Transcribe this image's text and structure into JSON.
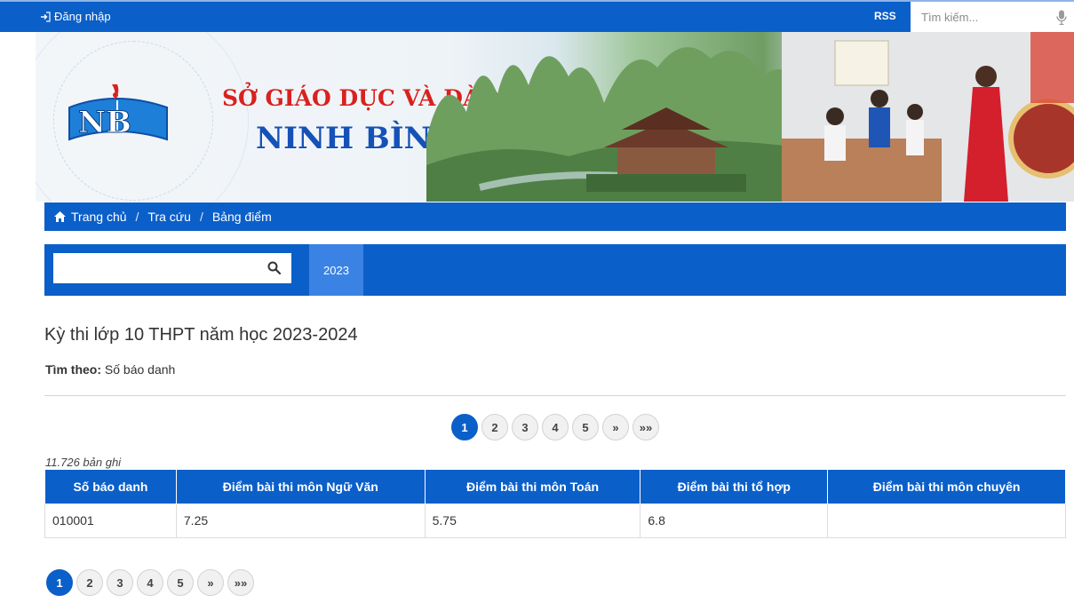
{
  "topbar": {
    "login_label": "Đăng nhập",
    "rss_label": "RSS",
    "search_placeholder": "Tìm kiếm..."
  },
  "banner": {
    "org_line1": "SỞ GIÁO DỤC VÀ ĐÀO TẠO",
    "org_line2": "NINH BÌNH",
    "logo_text": "NB"
  },
  "breadcrumb": [
    {
      "label": "Trang chủ",
      "icon": "home-icon"
    },
    {
      "label": "Tra cứu"
    },
    {
      "label": "Bảng điểm"
    }
  ],
  "search_panel": {
    "query": "",
    "year_tab": "2023"
  },
  "content": {
    "title": "Kỳ thi lớp 10 THPT năm học 2023-2024",
    "find_by_label": "Tìm theo:",
    "find_by_value": "Số báo danh",
    "record_count": "11.726 bản ghi"
  },
  "pagination": {
    "pages": [
      "1",
      "2",
      "3",
      "4",
      "5"
    ],
    "current": "1",
    "next": "»",
    "last": "»»"
  },
  "table": {
    "headers": [
      "Số báo danh",
      "Điểm bài thi môn Ngữ Văn",
      "Điểm bài thi môn Toán",
      "Điểm bài thi tổ hợp",
      "Điểm bài thi môn chuyên"
    ],
    "rows": [
      [
        "010001",
        "7.25",
        "5.75",
        "6.8",
        ""
      ]
    ]
  },
  "colors": {
    "primary": "#0b5fc9",
    "year_tab": "#3a82e4"
  }
}
